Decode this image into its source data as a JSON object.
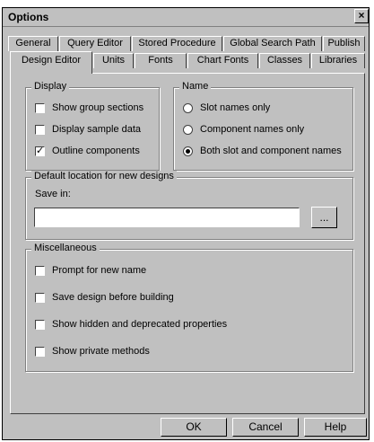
{
  "window": {
    "title": "Options",
    "close_glyph": "×"
  },
  "tabs_back": [
    {
      "label": "General"
    },
    {
      "label": "Query Editor"
    },
    {
      "label": "Stored Procedure"
    },
    {
      "label": "Global Search Path"
    },
    {
      "label": "Publish"
    }
  ],
  "tabs_front": [
    {
      "label": "Design Editor",
      "active": true
    },
    {
      "label": "Units"
    },
    {
      "label": "Fonts"
    },
    {
      "label": "Chart Fonts"
    },
    {
      "label": "Classes"
    },
    {
      "label": "Libraries"
    }
  ],
  "display": {
    "legend": "Display",
    "items": [
      {
        "label": "Show group sections",
        "checked": false
      },
      {
        "label": "Display sample data",
        "checked": false
      },
      {
        "label": "Outline components",
        "checked": true
      }
    ]
  },
  "name_group": {
    "legend": "Name",
    "options": [
      {
        "label": "Slot names only",
        "selected": false
      },
      {
        "label": "Component names only",
        "selected": false
      },
      {
        "label": "Both slot and component names",
        "selected": true
      }
    ]
  },
  "location": {
    "legend": "Default location for new designs",
    "save_in_label": "Save in:",
    "save_in_value": "",
    "browse_label": "..."
  },
  "misc": {
    "legend": "Miscellaneous",
    "items": [
      {
        "label": "Prompt for new name",
        "checked": false
      },
      {
        "label": "Save design before building",
        "checked": false
      },
      {
        "label": "Show hidden and deprecated properties",
        "checked": false
      },
      {
        "label": "Show private methods",
        "checked": false
      }
    ]
  },
  "buttons": {
    "ok": "OK",
    "cancel": "Cancel",
    "help": "Help"
  },
  "check_glyph": "✓"
}
